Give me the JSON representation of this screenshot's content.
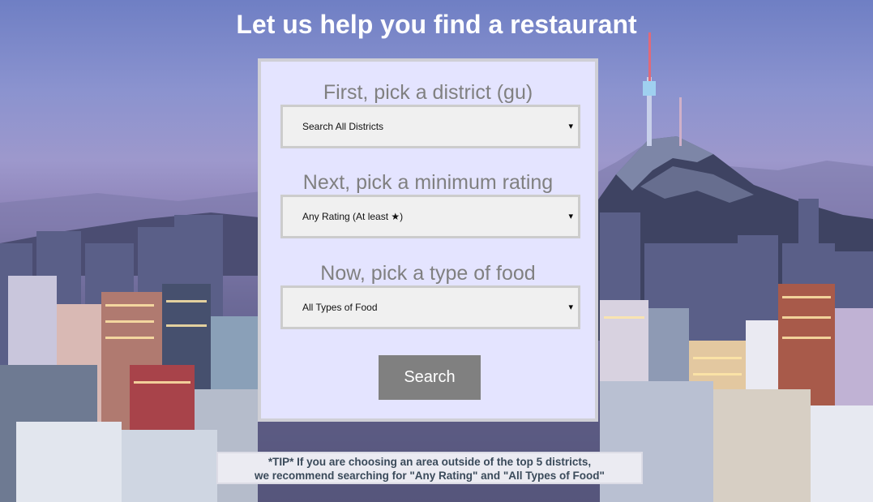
{
  "header": {
    "title": "Let us help you find a restaurant"
  },
  "form": {
    "district": {
      "label": "First, pick a district (gu)",
      "selected": "Search All Districts"
    },
    "rating": {
      "label": "Next, pick a minimum rating",
      "selected": "Any Rating (At least ★)"
    },
    "food": {
      "label": "Now, pick a type of food",
      "selected": "All Types of Food"
    },
    "dropdown_arrow": "▾",
    "search_label": "Search"
  },
  "tip": {
    "line1": "*TIP* If you are choosing an area outside of the top 5 districts,",
    "line2": "we recommend searching for \"Any Rating\" and \"All Types of Food\""
  },
  "colors": {
    "panel_bg": "#e4e4ff",
    "button_bg": "#808080",
    "label_text": "#808080",
    "select_bg": "#f0f0f0"
  }
}
